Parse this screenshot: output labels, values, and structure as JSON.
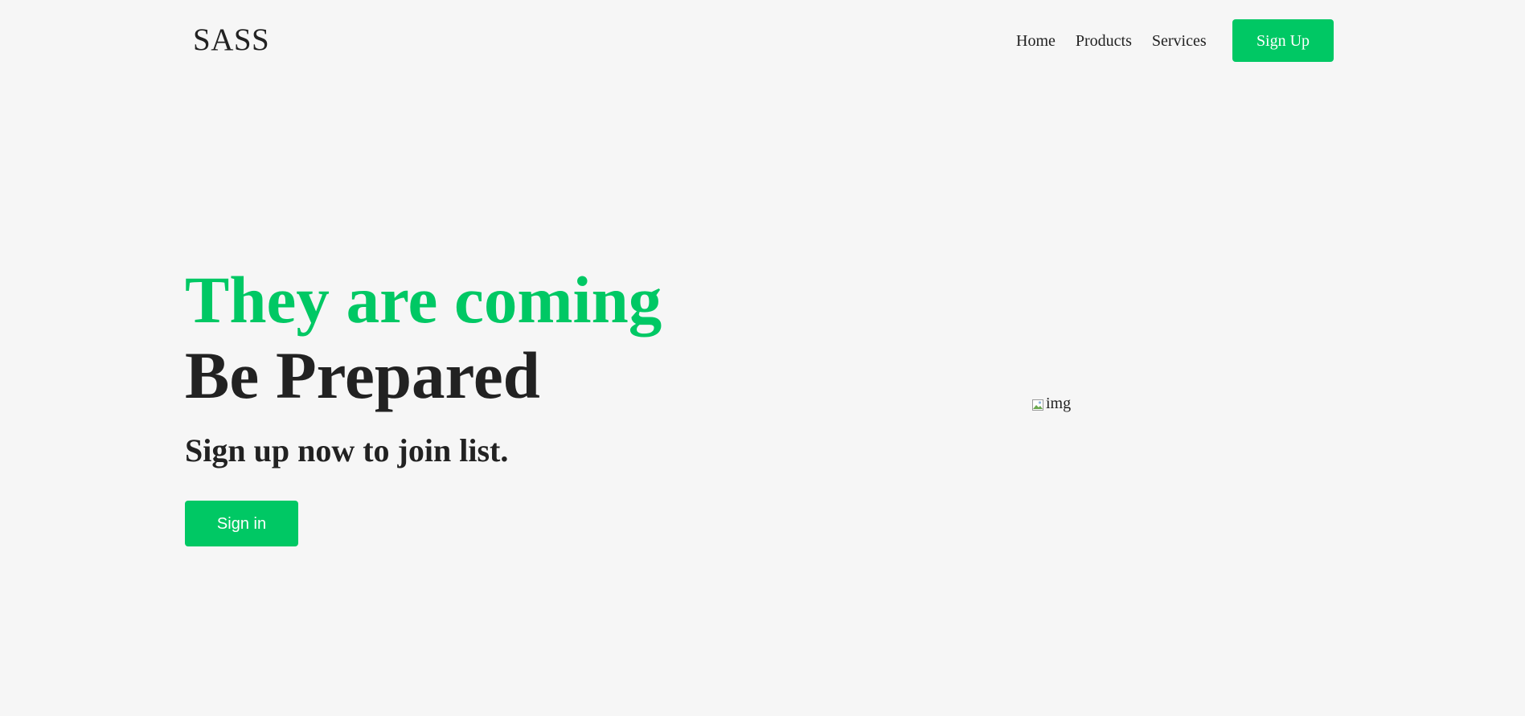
{
  "navbar": {
    "logo": "SASS",
    "links": [
      "Home",
      "Products",
      "Services"
    ],
    "signup_label": "Sign Up"
  },
  "hero": {
    "headline_line1": "They are coming",
    "headline_line2": "Be Prepared",
    "subheadline": "Sign up now to join list.",
    "signin_label": "Sign in",
    "image_alt": "img"
  },
  "icons": {
    "broken_image": "broken-image-icon"
  },
  "colors": {
    "accent": "#00c864",
    "text": "#222222",
    "background": "#f6f6f6",
    "button_text": "#ffffff"
  }
}
